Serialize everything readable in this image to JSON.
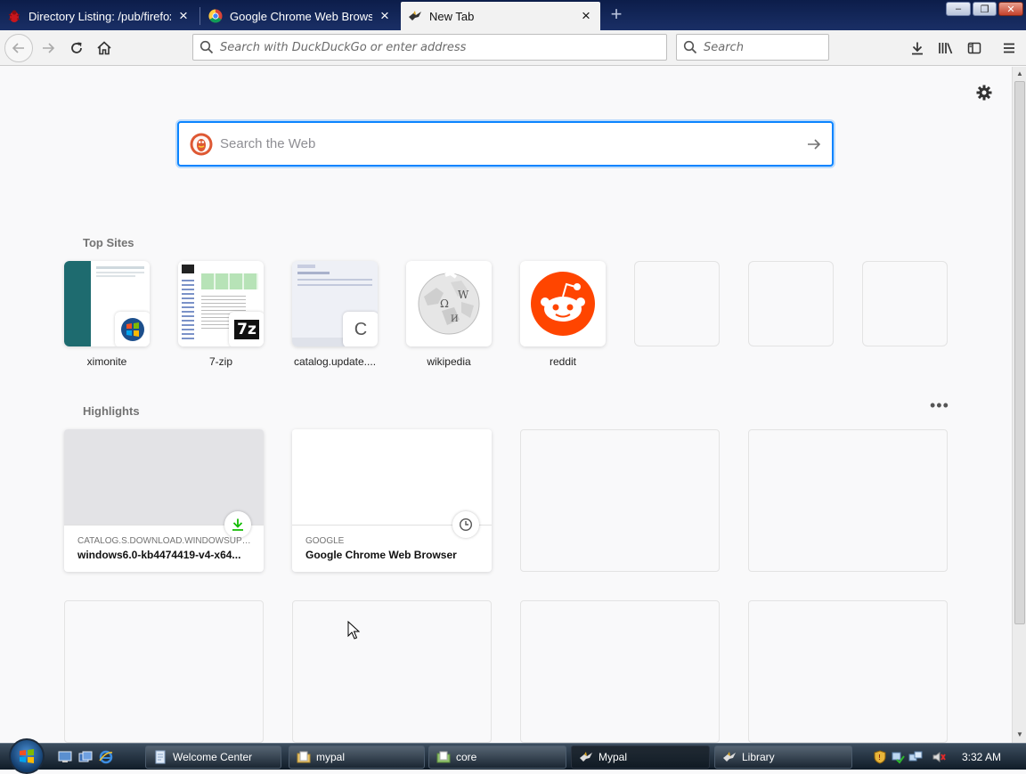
{
  "window": {
    "tabs": [
      {
        "title": "Directory Listing: /pub/firefox/",
        "icon": "bug-icon"
      },
      {
        "title": "Google Chrome Web Browser",
        "icon": "chrome-icon"
      },
      {
        "title": "New Tab",
        "icon": "mypal-icon",
        "active": true
      }
    ],
    "controls": {
      "minimize": "–",
      "maximize": "❐",
      "close": "✕"
    }
  },
  "navbar": {
    "url_placeholder": "Search with DuckDuckGo or enter address",
    "search_placeholder": "Search"
  },
  "newtab": {
    "websearch_placeholder": "Search the Web",
    "top_sites_title": "Top Sites",
    "top_sites": [
      {
        "label": "ximonite",
        "badge": "windows-logo-icon"
      },
      {
        "label": "7-zip",
        "badge": "7z"
      },
      {
        "label": "catalog.update....",
        "badge": "C"
      },
      {
        "label": "wikipedia"
      },
      {
        "label": "reddit"
      },
      {
        "label": ""
      },
      {
        "label": ""
      },
      {
        "label": ""
      }
    ],
    "highlights_title": "Highlights",
    "highlights": [
      {
        "source": "CATALOG.S.DOWNLOAD.WINDOWSUPDA...",
        "title": "windows6.0-kb4474419-v4-x64...",
        "icon": "download-icon"
      },
      {
        "source": "GOOGLE",
        "title": "Google Chrome Web Browser",
        "icon": "clock-icon"
      }
    ]
  },
  "taskbar": {
    "buttons": [
      {
        "label": "Welcome Center"
      },
      {
        "label": "mypal"
      },
      {
        "label": "core"
      },
      {
        "label": "Mypal",
        "active": true
      },
      {
        "label": "Library"
      }
    ],
    "clock": "3:32 AM"
  },
  "colors": {
    "accent": "#0a84ff",
    "reddit": "#ff4500",
    "download_green": "#12bc00"
  }
}
